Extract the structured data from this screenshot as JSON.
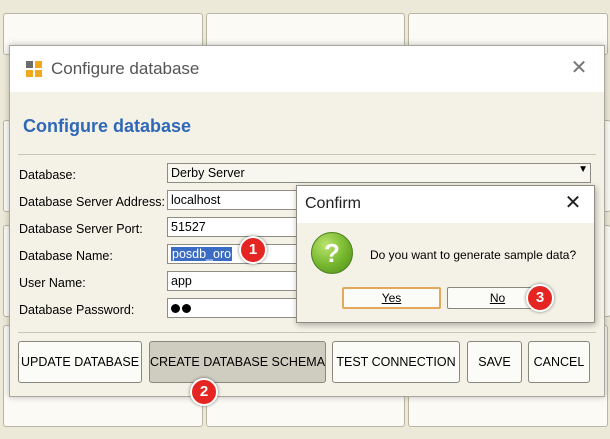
{
  "main_dialog": {
    "title": "Configure database",
    "heading": "Configure database",
    "fields": {
      "database": {
        "label": "Database:",
        "value": "Derby Server"
      },
      "server_address": {
        "label": "Database Server Address:",
        "value": "localhost"
      },
      "server_port": {
        "label": "Database Server Port:",
        "value": "51527"
      },
      "database_name": {
        "label": "Database Name:",
        "value": "posdb_oro"
      },
      "user_name": {
        "label": "User Name:",
        "value": "app"
      },
      "database_password": {
        "label": "Database Password:",
        "masked_length": 2
      }
    },
    "buttons": {
      "update_database": "UPDATE DATABASE",
      "create_schema": "CREATE DATABASE SCHEMA",
      "test_connection": "TEST CONNECTION",
      "save": "SAVE",
      "cancel": "CANCEL"
    }
  },
  "confirm_dialog": {
    "title": "Confirm",
    "message": "Do you want to generate sample data?",
    "yes_label": "Yes",
    "no_label": "No"
  },
  "annotations": [
    "1",
    "2",
    "3"
  ],
  "icons": {
    "app": "app-logo-icon",
    "close": "close-icon",
    "question": "question-icon",
    "dropdown": "chevron-down-icon"
  },
  "colors": {
    "heading": "#2f68b8",
    "selection": "#3a6cc4",
    "badge": "#e52521",
    "question_icon": "#74b52d",
    "default_button_border": "#e5a85a"
  }
}
